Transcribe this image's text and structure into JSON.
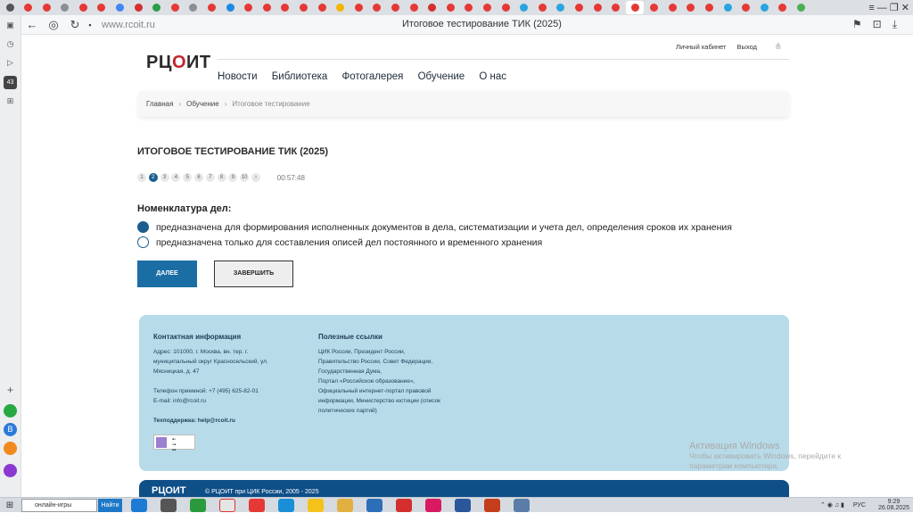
{
  "browser": {
    "url": "www.rcoit.ru",
    "page_title": "Итоговое тестирование ТИК (2025)",
    "sidebar_badge": "43"
  },
  "site": {
    "logo": "РЦОИТ",
    "top_links": [
      "Личный кабинет",
      "Выход"
    ],
    "nav": [
      "Новости",
      "Библиотека",
      "Фотогалерея",
      "Обучение",
      "О нас"
    ],
    "breadcrumb": [
      "Главная",
      "Обучение",
      "Итоговое тестирование"
    ]
  },
  "test": {
    "title": "ИТОГОВОЕ ТЕСТИРОВАНИЕ ТИК (2025)",
    "questions": [
      "1",
      "2",
      "3",
      "4",
      "5",
      "6",
      "7",
      "8",
      "9",
      "10",
      "›"
    ],
    "current_question": 2,
    "timer": "00:57:48",
    "question": "Номенклатура дел:",
    "options": [
      {
        "text": "предназначена для формирования исполненных документов в дела, систематизации и учета дел, определения сроков их хранения",
        "selected": true
      },
      {
        "text": "предназначена только для составления описей дел постоянного и временного хранения",
        "selected": false
      }
    ],
    "next_label": "ДАЛЕЕ",
    "finish_label": "ЗАВЕРШИТЬ"
  },
  "footer": {
    "contact_title": "Контактная информация",
    "address_lines": [
      "Адрес: 101000, г. Москва, вн. тер. г.",
      "муниципальный округ Красносельский, ул.",
      "Мясницкая, д. 47"
    ],
    "phone": "Телефон приемной: +7 (495) 625-82-01",
    "email": "E-mail: info@rcoit.ru",
    "support": "Техподдержка: help@rcoit.ru",
    "links_title": "Полезные ссылки",
    "links_lines": [
      "ЦИК России, Президент России,",
      "Правительство России, Совет Федерации,",
      "Государственная Дума,",
      "Портал «Российское образование»,",
      "Официальный интернет-портал правовой",
      "информации, Министерство юстиции (список",
      "политических партий)"
    ],
    "bottom_text": "© РЦОИТ при ЦИК России, 2005 - 2025"
  },
  "watermark": {
    "title": "Активация Windows",
    "text": "Чтобы активировать Windows, перейдите к параметрам компьютера."
  },
  "taskbar": {
    "search_placeholder": "онлайн-игры",
    "search_button": "Найти",
    "lang": "РУС",
    "time": "9:29",
    "date": "26.08.2025"
  }
}
